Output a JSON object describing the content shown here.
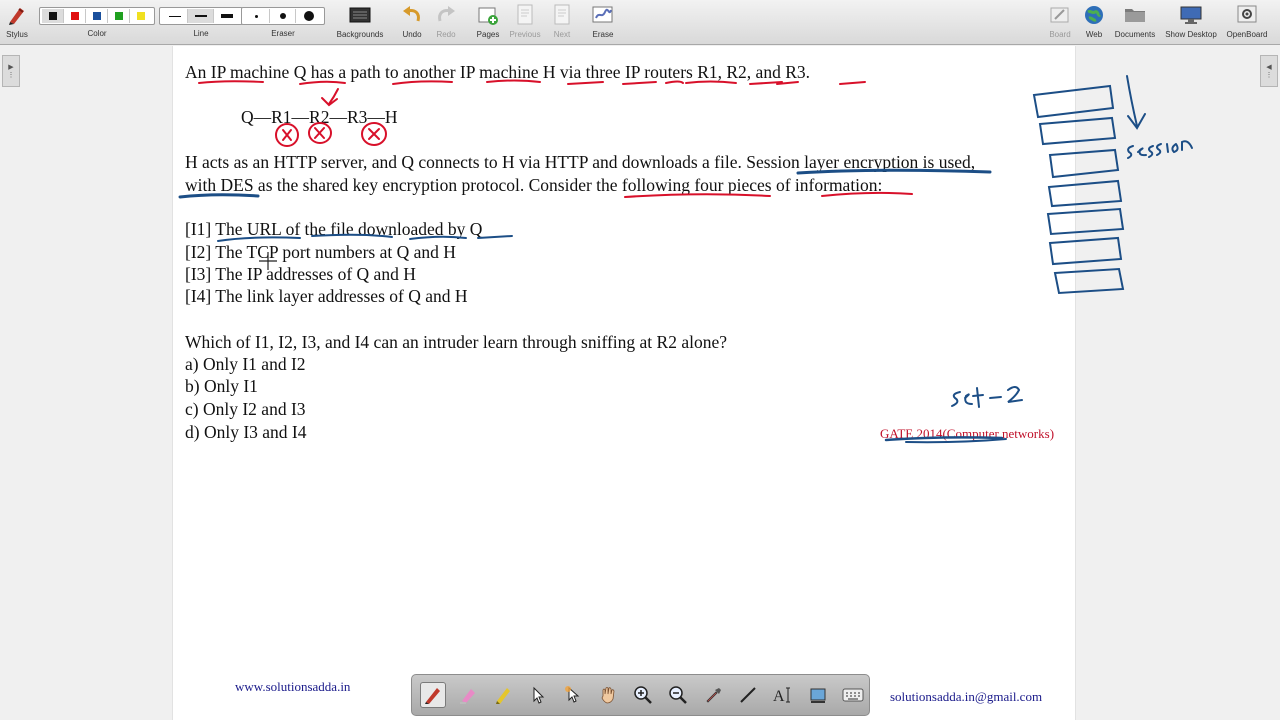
{
  "toolbar": {
    "stylus": "Stylus",
    "color": "Color",
    "line": "Line",
    "eraser": "Eraser",
    "backgrounds": "Backgrounds",
    "undo": "Undo",
    "redo": "Redo",
    "pages": "Pages",
    "previous": "Previous",
    "next": "Next",
    "erase": "Erase",
    "board": "Board",
    "web": "Web",
    "documents": "Documents",
    "show_desktop": "Show Desktop",
    "openboard": "OpenBoard"
  },
  "colors": {
    "palette": [
      "#111111",
      "#e01010",
      "#1a4f9c",
      "#20a020",
      "#f0e020"
    ],
    "ink_red": "#d8102a",
    "ink_blue": "#1c4e86",
    "footer_blue": "#1a1a8a"
  },
  "question": {
    "intro": "An IP machine Q has a path to another IP machine H via three IP routers R1, R2, and R3.",
    "path": "Q—R1—R2—R3—H",
    "line1": "H acts as an HTTP server, and Q connects to H via HTTP and downloads a file. Session layer encryption is used,",
    "line2": "with DES as the shared key encryption protocol. Consider the following four pieces of information:",
    "items": [
      "[I1] The URL of the file downloaded by Q",
      "[I2] The TCP port numbers at Q and H",
      "[I3] The IP addresses of Q and H",
      "[I4] The link layer addresses of Q and H"
    ],
    "prompt": "Which of I1, I2, I3, and I4 can an intruder learn through sniffing at R2 alone?",
    "options": [
      "a) Only I1 and I2",
      "b) Only I1",
      "c) Only I2 and I3",
      "d) Only I3 and I4"
    ]
  },
  "gate_label": "GATE 2014(Computer networks)",
  "footer": {
    "website": "www.solutionsadda.in",
    "email": "solutionsadda.in@gmail.com"
  },
  "floating_tools": [
    "pen-icon",
    "highlighter-icon",
    "marker-icon",
    "pointer-icon",
    "laser-icon",
    "hand-icon",
    "zoom-in-icon",
    "zoom-out-icon",
    "pipette-icon",
    "line-icon",
    "text-icon",
    "capture-icon",
    "keyboard-icon"
  ]
}
